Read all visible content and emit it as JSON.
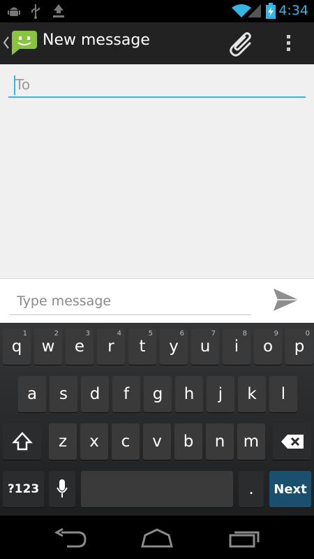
{
  "status_bar": {
    "time": "4:34"
  },
  "action_bar": {
    "title": "New message"
  },
  "to_field": {
    "placeholder": "To"
  },
  "compose": {
    "placeholder": "Type message"
  },
  "keyboard": {
    "row1": [
      {
        "label": "q",
        "hint": "1"
      },
      {
        "label": "w",
        "hint": "2"
      },
      {
        "label": "e",
        "hint": "3"
      },
      {
        "label": "r",
        "hint": "4"
      },
      {
        "label": "t",
        "hint": "5"
      },
      {
        "label": "y",
        "hint": "6"
      },
      {
        "label": "u",
        "hint": "7"
      },
      {
        "label": "i",
        "hint": "8"
      },
      {
        "label": "o",
        "hint": "9"
      },
      {
        "label": "p",
        "hint": "0"
      }
    ],
    "row2": [
      "a",
      "s",
      "d",
      "f",
      "g",
      "h",
      "j",
      "k",
      "l"
    ],
    "row3": [
      "z",
      "x",
      "c",
      "v",
      "b",
      "n",
      "m"
    ],
    "symbols_label": "?123",
    "period_label": ".",
    "next_label": "Next"
  },
  "colors": {
    "accent": "#33b5e5",
    "next_key": "#1b4f6e"
  }
}
